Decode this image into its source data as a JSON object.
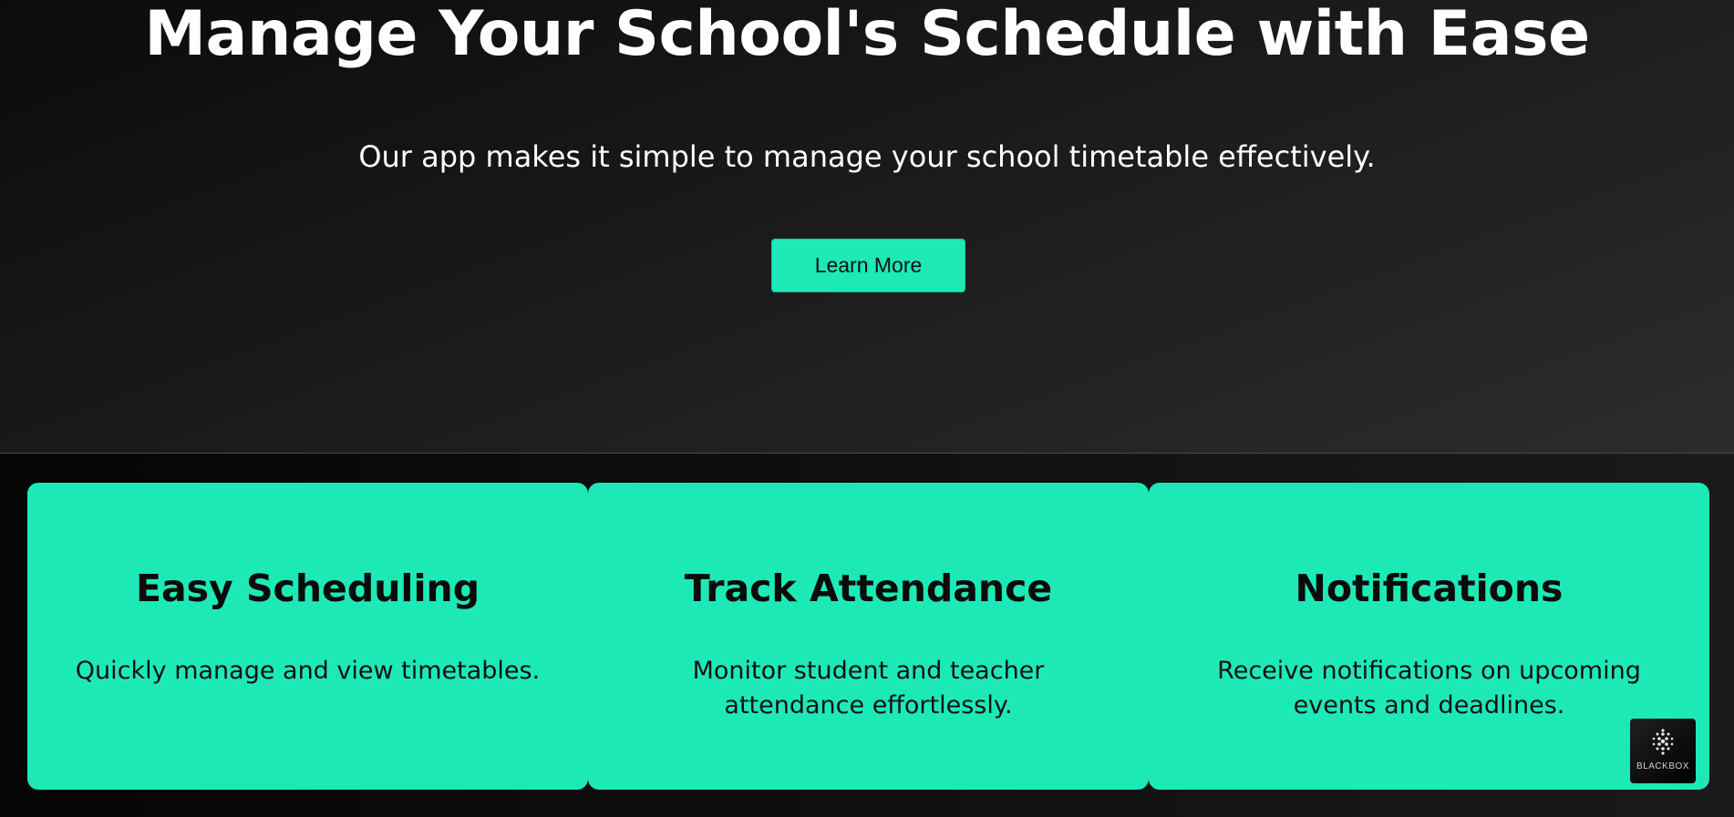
{
  "hero": {
    "title": "Manage Your School's Schedule with Ease",
    "subtitle": "Our app makes it simple to manage your school timetable effectively.",
    "button_label": "Learn More"
  },
  "features": [
    {
      "title": "Easy Scheduling",
      "description": "Quickly manage and view timetables."
    },
    {
      "title": "Track Attendance",
      "description": "Monitor student and teacher attendance effortlessly."
    },
    {
      "title": "Notifications",
      "description": "Receive notifications on upcoming events and deadlines."
    }
  ],
  "badge": {
    "label": "BLACKBOX",
    "icon": "blackbox-logo-icon"
  },
  "colors": {
    "accent": "#1de9b6",
    "hero_text": "#ffffff",
    "card_text": "#0b0b0b"
  }
}
